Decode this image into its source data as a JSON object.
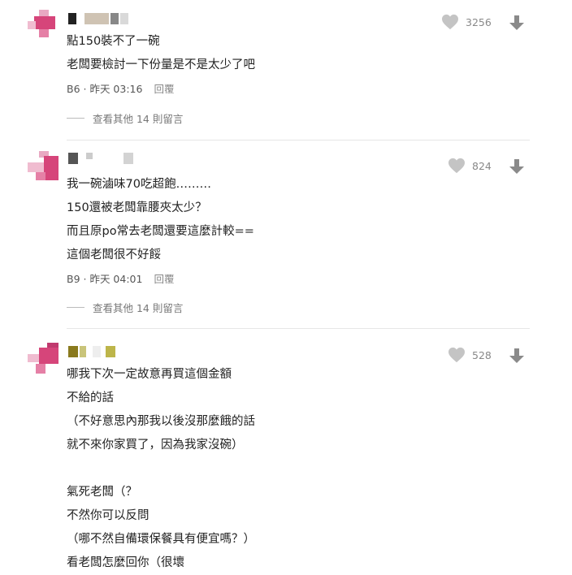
{
  "comments": [
    {
      "lines": [
        "點150裝不了一碗",
        "老闆要檢討一下份量是不是太少了吧"
      ],
      "floor": "B6",
      "time": "昨天 03:16",
      "reply_label": "回覆",
      "likes": "3256",
      "more_replies": "查看其他 14 則留言"
    },
    {
      "lines": [
        "我一碗滷味70吃超飽………",
        "150還被老闆靠腰夾太少？",
        "而且原po常去老闆還要這麼計較==",
        "這個老闆很不好餒"
      ],
      "floor": "B9",
      "time": "昨天 04:01",
      "reply_label": "回覆",
      "likes": "824",
      "more_replies": "查看其他 14 則留言"
    },
    {
      "lines": [
        "哪我下次一定故意再買這個金額",
        "不給的話",
        "（不好意思內那我以後沒那麼餓的話",
        "就不來你家買了，因為我家沒碗）",
        "",
        "氣死老闆（？",
        "不然你可以反問",
        "（哪不然自備環保餐具有便宜嗎？）",
        "看老闆怎麼回你（很壞"
      ],
      "likes": "528"
    }
  ],
  "colors": {
    "heart": "#c4c4c4",
    "arrow": "#8a8a8a",
    "avatar_pink": "#d6457a"
  }
}
